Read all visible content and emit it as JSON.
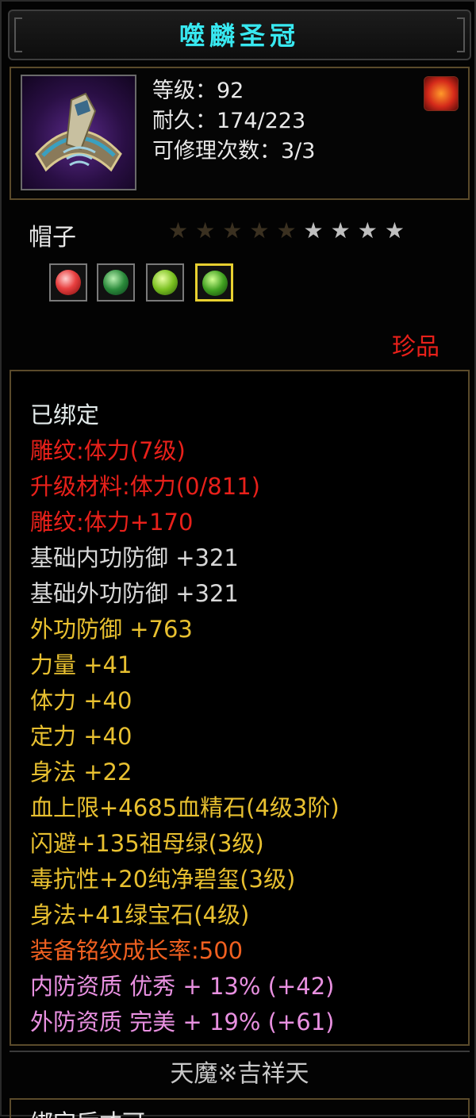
{
  "title": "噬麟圣冠",
  "header": {
    "level": "等级：92",
    "durability": "耐久：174/223",
    "repair": "可修理次数：3/3"
  },
  "item_type": "帽子",
  "stars": {
    "lit": 5,
    "total": 9
  },
  "rarity": "珍品",
  "attributes": [
    {
      "text": "已绑定",
      "color": "white"
    },
    {
      "text": "雕纹:体力(7级)",
      "color": "red"
    },
    {
      "text": "升级材料:体力(0/811)",
      "color": "red"
    },
    {
      "text": "雕纹:体力+170",
      "color": "red"
    },
    {
      "text": "基础内功防御 +321",
      "color": "gray"
    },
    {
      "text": "基础外功防御 +321",
      "color": "gray"
    },
    {
      "text": "外功防御 +763",
      "color": "yellow"
    },
    {
      "text": "力量 +41",
      "color": "yellow"
    },
    {
      "text": "体力 +40",
      "color": "yellow"
    },
    {
      "text": "定力 +40",
      "color": "yellow"
    },
    {
      "text": "身法 +22",
      "color": "yellow"
    },
    {
      "text": "血上限+4685血精石(4级3阶)",
      "color": "yellow"
    },
    {
      "text": "闪避+135祖母绿(3级)",
      "color": "yellow"
    },
    {
      "text": "毒抗性+20纯净碧玺(3级)",
      "color": "yellow"
    },
    {
      "text": "身法+41绿宝石(4级)",
      "color": "yellow"
    },
    {
      "text": "装备铭纹成长率:500",
      "color": "orange"
    },
    {
      "text": "内防资质 优秀 + 13% (+42)",
      "color": "pink"
    },
    {
      "text": "外防资质 完美 + 19% (+61)",
      "color": "pink"
    }
  ],
  "set_name": "天魔※吉祥天",
  "cutoff_text": "绑定后才可..."
}
